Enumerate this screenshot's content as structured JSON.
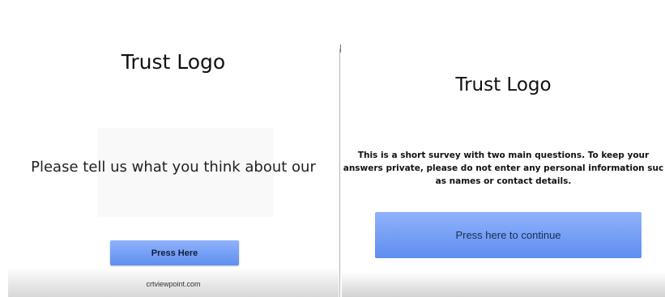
{
  "left_screen": {
    "logo_text": "Trust Logo",
    "intro_text": "Please tell us what you think about our",
    "button_label": "Press Here",
    "footer_text": "crtviewpoint.com"
  },
  "right_screen": {
    "logo_text": "Trust Logo",
    "notice_lines": [
      "This is a short survey with two main questions. To keep your",
      "answers private, please do not enter any personal information suc",
      "as names or contact details."
    ],
    "button_label": "Press here to continue"
  }
}
